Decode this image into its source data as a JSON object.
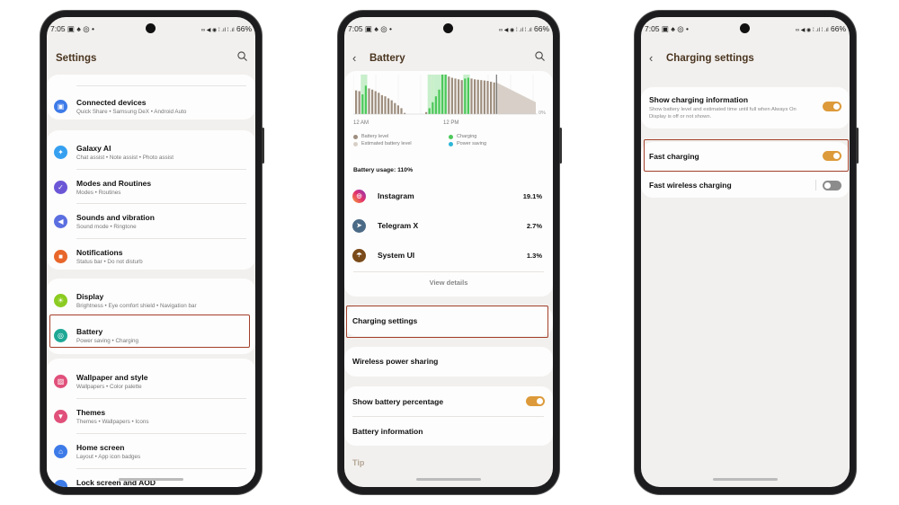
{
  "status_bar": {
    "time": "7:05",
    "left_icons": "▣ ♠ ◎ •",
    "right_icons": "∞ ◀ ◉ ⁞ .ıl ⁞ .ıl",
    "battery": "66%"
  },
  "settings": {
    "title": "Settings",
    "items": [
      {
        "label": "Connected devices",
        "sub": "Quick Share • Samsung DeX • Android Auto",
        "icon": "connected-devices-icon",
        "color": "#3d7be8",
        "glyph": "▣"
      },
      {
        "label": "Galaxy AI",
        "sub": "Chat assist • Note assist • Photo assist",
        "icon": "galaxy-ai-icon",
        "color": "#36a0f0",
        "glyph": "✦"
      },
      {
        "label": "Modes and Routines",
        "sub": "Modes • Routines",
        "icon": "modes-routines-icon",
        "color": "#6b57d6",
        "glyph": "✓"
      },
      {
        "label": "Sounds and vibration",
        "sub": "Sound mode • Ringtone",
        "icon": "sound-icon",
        "color": "#5b6fe0",
        "glyph": "◀"
      },
      {
        "label": "Notifications",
        "sub": "Status bar • Do not disturb",
        "icon": "notifications-icon",
        "color": "#e8662a",
        "glyph": "■"
      },
      {
        "label": "Display",
        "sub": "Brightness • Eye comfort shield • Navigation bar",
        "icon": "display-icon",
        "color": "#8ccc22",
        "glyph": "☀"
      },
      {
        "label": "Battery",
        "sub": "Power saving • Charging",
        "icon": "battery-icon",
        "color": "#1ea895",
        "glyph": "◎"
      },
      {
        "label": "Wallpaper and style",
        "sub": "Wallpapers • Color palette",
        "icon": "wallpaper-icon",
        "color": "#e0507a",
        "glyph": "▨"
      },
      {
        "label": "Themes",
        "sub": "Themes • Wallpapers • Icons",
        "icon": "themes-icon",
        "color": "#e0507a",
        "glyph": "▼"
      },
      {
        "label": "Home screen",
        "sub": "Layout • App icon badges",
        "icon": "home-screen-icon",
        "color": "#3d7be8",
        "glyph": "⌂"
      },
      {
        "label": "Lock screen and AOD",
        "sub": "",
        "icon": "lock-screen-icon",
        "color": "#3d7be8",
        "glyph": ""
      }
    ]
  },
  "battery": {
    "title": "Battery",
    "chart": {
      "levels": [
        60,
        58,
        50,
        72,
        65,
        62,
        58,
        54,
        48,
        45,
        40,
        35,
        28,
        22,
        15,
        3
      ],
      "levels_right": [
        5,
        15,
        30,
        45,
        62,
        100,
        100,
        95,
        92,
        90,
        88,
        86,
        90,
        92,
        90,
        88,
        87,
        86,
        85,
        84,
        82,
        80
      ],
      "charging_left": [
        false,
        false,
        true,
        true,
        false,
        false,
        false,
        false,
        false,
        false,
        false,
        false,
        false,
        false,
        false,
        false
      ],
      "charging_right": [
        false,
        true,
        true,
        true,
        true,
        true,
        true,
        false,
        false,
        false,
        false,
        false,
        true,
        true,
        false,
        false,
        false,
        false,
        false,
        false,
        false,
        false
      ],
      "estimated": [
        80,
        30
      ],
      "x_labels": [
        "12 AM",
        "12 PM"
      ],
      "y_label": "0%",
      "colors": {
        "battery": "#9e8e7e",
        "estimated": "#d8d0c8",
        "charging": "#4cc85a",
        "charging_band": "#c8efcb",
        "power_saving": "#2bb6d8"
      }
    },
    "legend": [
      "Battery level",
      "Estimated battery level",
      "Charging",
      "Power saving"
    ],
    "usage_label": "Battery usage: 110%",
    "apps": [
      {
        "name": "Instagram",
        "value": "19.1%",
        "icon": "instagram-icon"
      },
      {
        "name": "Telegram X",
        "value": "2.7%",
        "icon": "telegram-icon"
      },
      {
        "name": "System UI",
        "value": "1.3%",
        "icon": "system-ui-icon"
      }
    ],
    "view_details": "View details",
    "charging_settings": "Charging settings",
    "wireless_power_sharing": "Wireless power sharing",
    "show_percentage": "Show battery percentage",
    "show_percentage_on": true,
    "battery_information": "Battery information",
    "tip": "Tip"
  },
  "charging": {
    "title": "Charging settings",
    "show_info": "Show charging information",
    "show_info_desc": "Show battery level and estimated time until full when Always On Display is off or not shown.",
    "show_info_on": true,
    "fast_charging": "Fast charging",
    "fast_charging_on": true,
    "fast_wireless": "Fast wireless charging",
    "fast_wireless_on": false
  },
  "accent": "#dd9a3a",
  "highlight": "#a3402b"
}
